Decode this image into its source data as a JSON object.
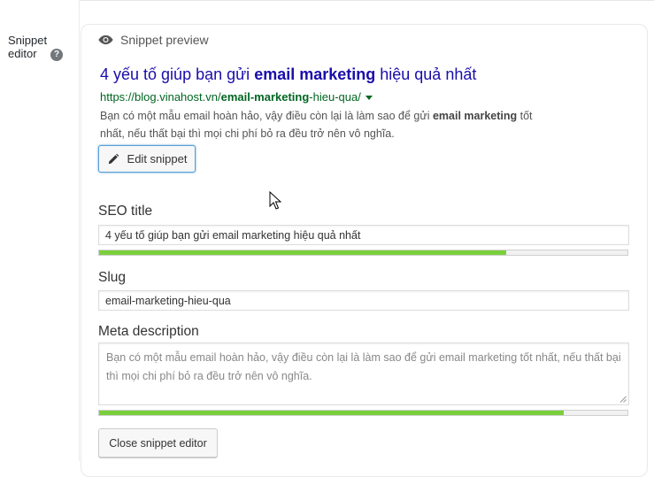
{
  "sidebar": {
    "label_line1": "Snippet",
    "label_line2": "editor",
    "help_icon": "question-circle-icon",
    "help_glyph": "?"
  },
  "preview": {
    "header_label": "Snippet preview",
    "header_icon": "eye-icon",
    "title_pre": "4 yếu tố giúp bạn gửi ",
    "title_bold": "email marketing",
    "title_post": " hiệu quả nhất",
    "url_pre": "https://blog.vinahost.vn/",
    "url_bold": "email-marketing",
    "url_post": "-hieu-qua/",
    "desc_pre": "Bạn có một mẫu email hoàn hảo, vậy điều còn lại là làm sao để gửi ",
    "desc_bold": "email marketing",
    "desc_post": " tốt nhất, nếu thất bại thì mọi chi phí bỏ ra đều trở nên vô nghĩa.",
    "edit_button_label": "Edit snippet",
    "edit_button_icon": "pencil-icon"
  },
  "form": {
    "seo_title_label": "SEO title",
    "seo_title_value": "4 yếu tố giúp bạn gửi email marketing hiệu quả nhất",
    "seo_title_progress": 0.77,
    "slug_label": "Slug",
    "slug_value": "email-marketing-hieu-qua",
    "meta_label": "Meta description",
    "meta_value": "Bạn có một mẫu email hoàn hảo, vậy điều còn lại là làm sao để gửi email marketing tốt nhất, nếu thất bại thì mọi chi phí bỏ ra đều trở nên vô nghĩa.",
    "meta_progress": 0.88,
    "close_button_label": "Close snippet editor"
  },
  "colors": {
    "serp_title": "#1a0dab",
    "serp_url": "#006621",
    "progress_good": "#7ad03a",
    "focus_border": "#5b9dd9"
  }
}
